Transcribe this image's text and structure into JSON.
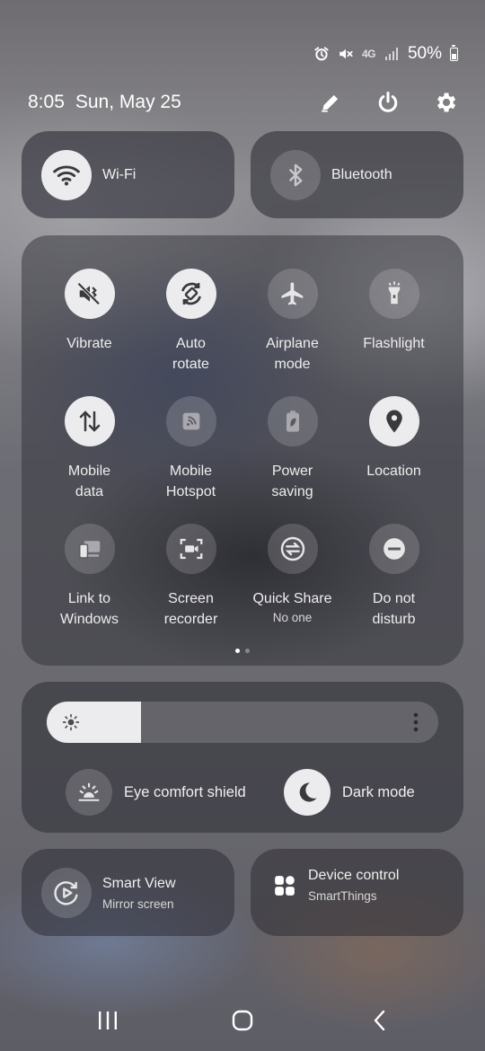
{
  "status_bar": {
    "battery": "50%",
    "network": "4G",
    "icons": [
      "alarm-icon",
      "mute-icon",
      "network-4g-icon",
      "signal-icon",
      "battery-icon"
    ]
  },
  "header": {
    "time": "8:05",
    "date": "Sun, May 25",
    "actions": [
      "edit-icon",
      "power-icon",
      "settings-icon"
    ]
  },
  "top_tiles": [
    {
      "label": "Wi-Fi",
      "state": "on",
      "icon": "wifi-icon"
    },
    {
      "label": "Bluetooth",
      "state": "off",
      "icon": "bluetooth-icon"
    }
  ],
  "quick_settings": [
    {
      "label": "Vibrate",
      "sub": "",
      "state": "on",
      "icon": "vibrate-icon"
    },
    {
      "label": "Auto\nrotate",
      "sub": "",
      "state": "on",
      "icon": "auto-rotate-icon"
    },
    {
      "label": "Airplane\nmode",
      "sub": "",
      "state": "off",
      "icon": "airplane-icon"
    },
    {
      "label": "Flashlight",
      "sub": "",
      "state": "off",
      "icon": "flashlight-icon"
    },
    {
      "label": "Mobile\ndata",
      "sub": "",
      "state": "on",
      "icon": "mobile-data-icon"
    },
    {
      "label": "Mobile\nHotspot",
      "sub": "",
      "state": "off",
      "icon": "hotspot-icon"
    },
    {
      "label": "Power\nsaving",
      "sub": "",
      "state": "off",
      "icon": "power-saving-icon"
    },
    {
      "label": "Location",
      "sub": "",
      "state": "on",
      "icon": "location-icon"
    },
    {
      "label": "Link to\nWindows",
      "sub": "",
      "state": "off",
      "icon": "link-to-windows-icon"
    },
    {
      "label": "Screen\nrecorder",
      "sub": "",
      "state": "off",
      "icon": "screen-recorder-icon"
    },
    {
      "label": "Quick Share",
      "sub": "No one",
      "state": "off",
      "icon": "quick-share-icon"
    },
    {
      "label": "Do not\ndisturb",
      "sub": "",
      "state": "off",
      "icon": "do-not-disturb-icon"
    }
  ],
  "pages": {
    "count": 2,
    "current": 1
  },
  "brightness": {
    "level": 0.24
  },
  "toggles": [
    {
      "label": "Eye comfort shield",
      "state": "off",
      "icon": "eye-comfort-icon"
    },
    {
      "label": "Dark mode",
      "state": "on",
      "icon": "moon-icon"
    }
  ],
  "bottom_tiles": [
    {
      "title": "Smart View",
      "subtitle": "Mirror screen",
      "icon": "smart-view-icon"
    },
    {
      "title": "Device control",
      "subtitle": "SmartThings",
      "icon": "device-control-icon"
    }
  ],
  "nav": [
    "recents-icon",
    "home-icon",
    "back-icon"
  ],
  "colors": {
    "tile_on": "#ececee",
    "tile_off": "rgba(255,255,255,0.16)",
    "icon_on": "#3a3a3c",
    "icon_off": "#e6e6e6"
  }
}
